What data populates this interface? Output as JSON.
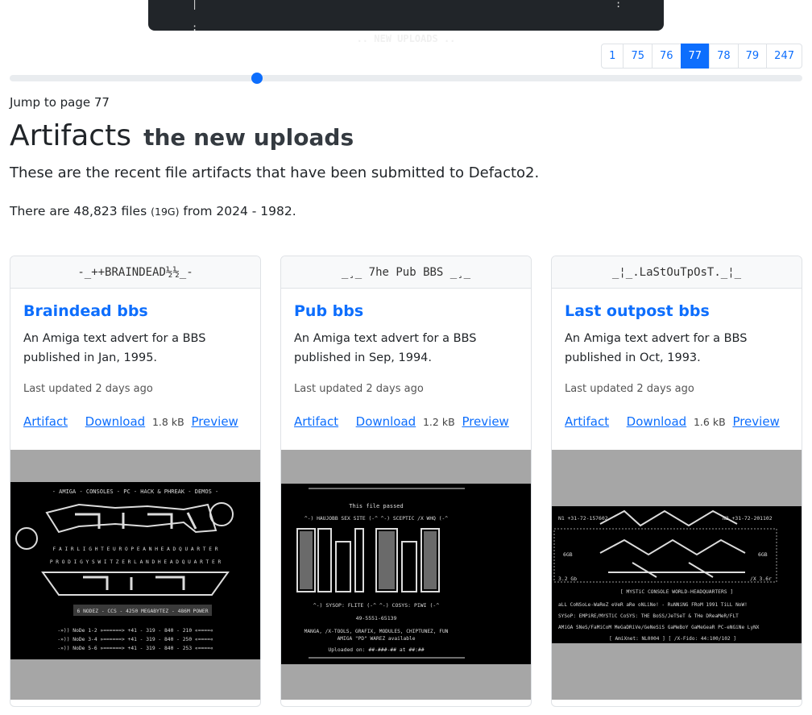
{
  "banner": {
    "title": ".. NEW UPLOADS ..",
    "left_mark": ":",
    "right_mark": ":"
  },
  "pagination": {
    "pages": [
      "1",
      "75",
      "76",
      "77",
      "78",
      "79",
      "247"
    ],
    "active": "77"
  },
  "slider": {
    "current_page": 77,
    "total_pages": 247
  },
  "jump_text": "Jump to page 77",
  "heading": {
    "main": "Artifacts",
    "sub": "the new uploads"
  },
  "lead": "These are the recent file artifacts that have been submitted to Defacto2.",
  "summary": {
    "prefix": "There are 48,823 files",
    "size": "(19G)",
    "suffix": "from 2024 - 1982."
  },
  "cards": [
    {
      "header": "-_++BRAINDEAD½½_-",
      "title": "Braindead bbs",
      "desc": "An Amiga text advert for a BBS published in Jan, 1995.",
      "updated": "Last updated 2 days ago",
      "artifact_label": "Artifact",
      "download_label": "Download",
      "size": "1.8 kB",
      "preview_label": "Preview"
    },
    {
      "header": "_¸_ 7he Pub BBS _¸_",
      "title": "Pub bbs",
      "desc": "An Amiga text advert for a BBS published in Sep, 1994.",
      "updated": "Last updated 2 days ago",
      "artifact_label": "Artifact",
      "download_label": "Download",
      "size": "1.2 kB",
      "preview_label": "Preview"
    },
    {
      "header": "_¦_.LaStOuTpOsT._¦_",
      "title": "Last outpost bbs",
      "desc": "An Amiga text advert for a BBS published in Oct, 1993.",
      "updated": "Last updated 2 days ago",
      "artifact_label": "Artifact",
      "download_label": "Download",
      "size": "1.6 kB",
      "preview_label": "Preview"
    }
  ],
  "previews": {
    "braindead": {
      "top": "- AMIGA - CONSOLES - PC - HACK & PHREAK - DEMOS -",
      "line1": "F A I R L I G H T  E U R O P E A N  H E A D Q U A R T E R",
      "line2": "P R O D I G Y  S W I T Z E R L A N D  H E A D Q U A R T E R",
      "nodes": "6 NODEZ - CCS - 4250 MEGABYTEZ - 486M POWER",
      "n1": "-»)) NoDe 1-2 »======> +41 - 319 - 840 - 210 «====«",
      "n2": "-»)) NoDe 3-4 »======> +41 - 319 - 840 - 250 «====«",
      "n3": "-»)) NoDe 5-6 »======> +41 - 319 - 840 - 253 «====«"
    },
    "pub": {
      "passed": "This file passed",
      "crew": "^-) HAUJOBB SEX SITE (-^ ^-) SCEPTIC /X WHQ (-^",
      "sysop": "^-) SYSOP: FLITE (-^ ^-) COSYS: PIWI (-^",
      "phone": "49-5551-65139",
      "stuff": "MANGA, /X-TOOLS, GRAFIX, MODULES, CHIPTUNEZ, FUN",
      "warez": "AMIGA \"PD\" WAREZ available",
      "uploaded": "Uploaded on: ##-###-## at ##:##"
    },
    "outpost": {
      "n1": "N1 +31-72-157602",
      "n2": "N2 +31-72-201102",
      "g1": "6GB",
      "g2": "6GB",
      "s1": "3.2 Gb",
      "s2": "/X 3.6r",
      "mystic": "[ MYSTiC CONSOLE WORLD-HEADQUARTERS ]",
      "all": "aLL CoNSoLe-WaReZ eVeR aRe oNLiNe! - RuNNiNG FRoM 1991 TiLL NoW!",
      "sysop": "SYSoP: EMPiRE/MYSTiC      CoSYS: THE BoSS/JeTSeT & THe DReaMeR/FLT",
      "amiga": "AMiGA SNeS/FaMiCoM MeGaDRiVe/GeNeSiS GaMeBoY GaMeGeaR PC-eNGiNe LyNX",
      "net": "[ AmiXnet: NL0004 ] [ /X-Fido: 44:100/102 ]"
    }
  }
}
